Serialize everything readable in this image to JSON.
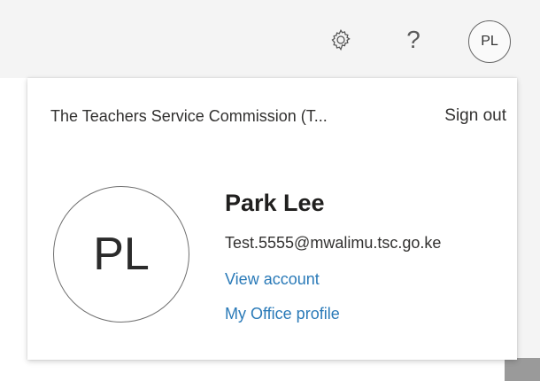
{
  "header": {
    "settings_icon": "gear-icon",
    "help_label": "?",
    "avatar_initials": "PL"
  },
  "account": {
    "org_name": "The Teachers Service Commission (T...",
    "sign_out_label": "Sign out",
    "avatar_initials": "PL",
    "user_name": "Park Lee",
    "email": "Test.5555@mwalimu.tsc.go.ke",
    "view_account_label": "View account",
    "office_profile_label": "My Office profile"
  },
  "colors": {
    "link": "#2a7ab8",
    "header_bg": "#f4f4f4",
    "text": "#323130"
  }
}
